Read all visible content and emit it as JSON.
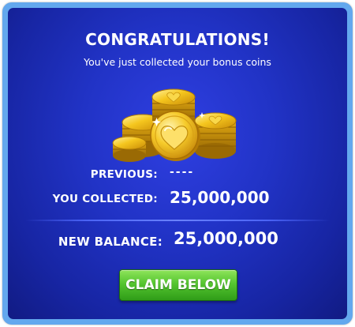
{
  "dialog": {
    "title": "CONGRATULATIONS!",
    "subtitle": "You've just collected your bonus coins",
    "previous_label": "PREVIOUS:",
    "previous_value": "----",
    "collected_label": "YOU COLLECTED:",
    "collected_value": "25,000,000",
    "balance_label": "NEW BALANCE:",
    "balance_value": "25,000,000",
    "claim_label": "CLAIM BELOW"
  },
  "icons": {
    "coins": "gold-coin-stack-heart-icon"
  },
  "colors": {
    "frame": "#63a8ee",
    "panel": "#2133c6",
    "button": "#4cbf2c",
    "coin": "#f2c21a"
  }
}
